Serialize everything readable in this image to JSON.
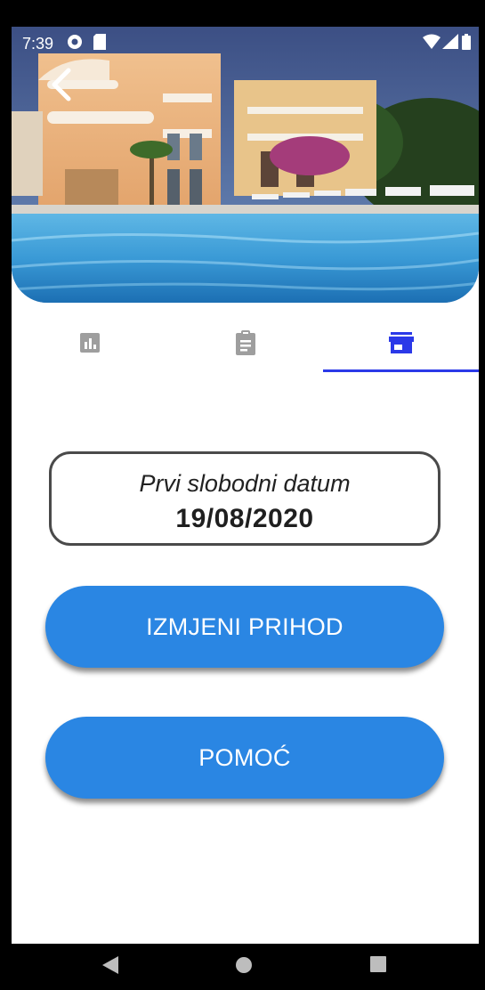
{
  "status_bar": {
    "time": "7:39",
    "icons": [
      "data-saver-icon",
      "sd-card-icon",
      "wifi-icon",
      "signal-icon",
      "battery-icon"
    ]
  },
  "header": {
    "back_icon": "back-arrow-icon",
    "image": "hotel-pool-photo"
  },
  "tabs": [
    {
      "icon": "bar-chart-icon",
      "selected": false
    },
    {
      "icon": "clipboard-icon",
      "selected": false
    },
    {
      "icon": "storefront-icon",
      "selected": true
    }
  ],
  "date_card": {
    "label": "Prvi slobodni datum",
    "value": "19/08/2020"
  },
  "buttons": {
    "edit_income": "IZMJENI PRIHOD",
    "help": "POMOĆ"
  },
  "navigation": {
    "icons": [
      "back-triangle-icon",
      "home-circle-icon",
      "recents-square-icon"
    ]
  },
  "colors": {
    "accent": "#2a86e3",
    "tab_indicator": "#2b39e8",
    "tab_selected": "#2b39e8",
    "tab_unselected": "#9e9e9e"
  }
}
